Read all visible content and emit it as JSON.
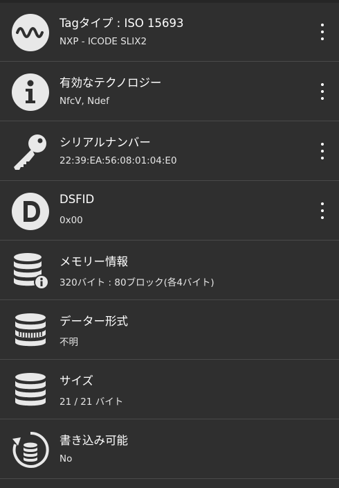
{
  "rows": [
    {
      "icon": "waveform-icon",
      "title": "Tagタイプ : ISO 15693",
      "value": "NXP - ICODE SLIX2",
      "has_menu": true
    },
    {
      "icon": "info-icon",
      "title": "有効なテクノロジー",
      "value": "NfcV, Ndef",
      "has_menu": true
    },
    {
      "icon": "key-icon",
      "title": "シリアルナンバー",
      "value": "22:39:EA:56:08:01:04:E0",
      "has_menu": true
    },
    {
      "icon": "d-letter-icon",
      "title": "DSFID",
      "value": "0x00",
      "has_menu": true
    },
    {
      "icon": "database-info-icon",
      "title": "メモリー情報",
      "value": "320バイト : 80ブロック(各4バイト)",
      "has_menu": false
    },
    {
      "icon": "database-format-icon",
      "title": "データー形式",
      "value": "不明",
      "has_menu": false
    },
    {
      "icon": "database-icon",
      "title": "サイズ",
      "value": "21 / 21 バイト",
      "has_menu": false
    },
    {
      "icon": "database-rewrite-icon",
      "title": "書き込み可能",
      "value": "No",
      "has_menu": false
    }
  ],
  "colors": {
    "background": "#2f2f2f",
    "divider": "#4a4a4a",
    "text_primary": "#ffffff",
    "icon": "#e8e8e8"
  }
}
